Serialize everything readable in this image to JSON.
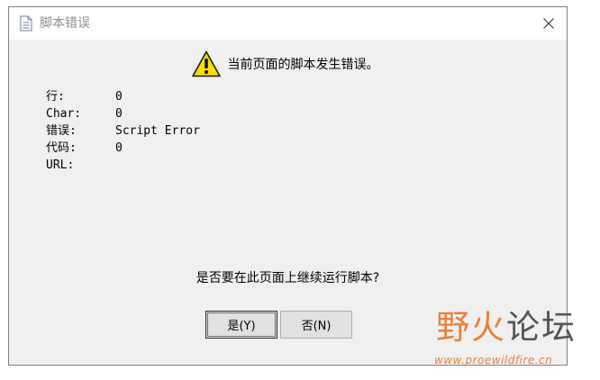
{
  "window": {
    "title": "脚本错误"
  },
  "message": {
    "headline": "当前页面的脚本发生错误。"
  },
  "details": [
    {
      "label": "行:",
      "value": "0"
    },
    {
      "label": "Char:",
      "value": "0"
    },
    {
      "label": "错误:",
      "value": "Script Error"
    },
    {
      "label": "代码:",
      "value": "0"
    },
    {
      "label": "URL:",
      "value": ""
    }
  ],
  "prompt": {
    "question": "是否要在此页面上继续运行脚本?"
  },
  "buttons": {
    "yes_label": "是(Y)",
    "no_label": "否(N)"
  },
  "watermark": {
    "title_accent": "野火",
    "title_rest": "论坛",
    "url": "www.proewildfire.cn"
  },
  "icons": {
    "document": "document-icon",
    "close": "close-icon",
    "warning": "warning-icon"
  },
  "colors": {
    "warning_fill": "#f5e000",
    "watermark_accent": "#e8803a"
  }
}
